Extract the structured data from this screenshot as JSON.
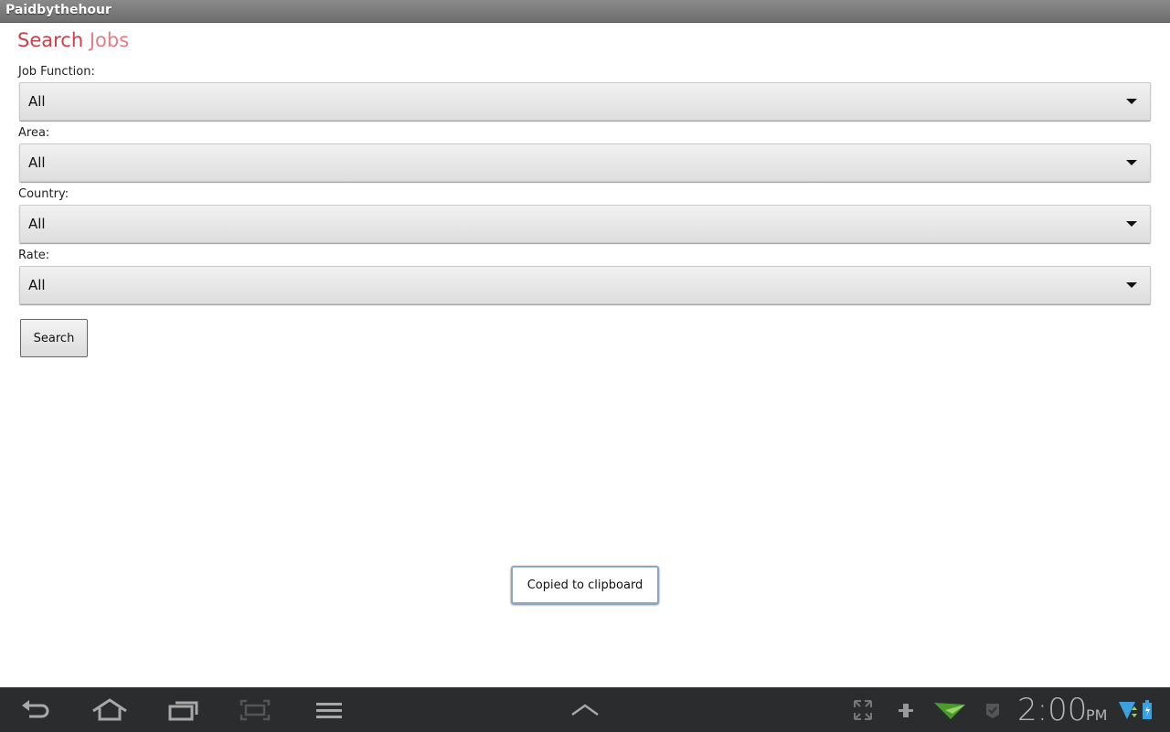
{
  "app": {
    "title": "Paidbythehour"
  },
  "page": {
    "heading_word1": "Search",
    "heading_word2": "Jobs"
  },
  "filters": [
    {
      "label": "Job Function:",
      "value": "All"
    },
    {
      "label": "Area:",
      "value": "All"
    },
    {
      "label": "Country:",
      "value": "All"
    },
    {
      "label": "Rate:",
      "value": "All"
    }
  ],
  "search_button": {
    "label": "Search"
  },
  "toast": {
    "text": "Copied to clipboard"
  },
  "system_bar": {
    "nav_icons": [
      "back-icon",
      "home-icon",
      "recent-apps-icon",
      "screenshot-icon",
      "menu-icon"
    ],
    "center_icon": "chevron-up-icon",
    "status_icons": [
      "fullscreen-icon",
      "usb-debug-icon",
      "airdroid-icon",
      "notification-icon",
      "wifi-icon",
      "battery-icon"
    ],
    "time": "2:00",
    "ampm": "PM",
    "colors": {
      "bar": "#2b2c2e",
      "icon": "#a8a8a8",
      "wifi": "#3aa0e0",
      "green": "#4a9a2c"
    }
  }
}
